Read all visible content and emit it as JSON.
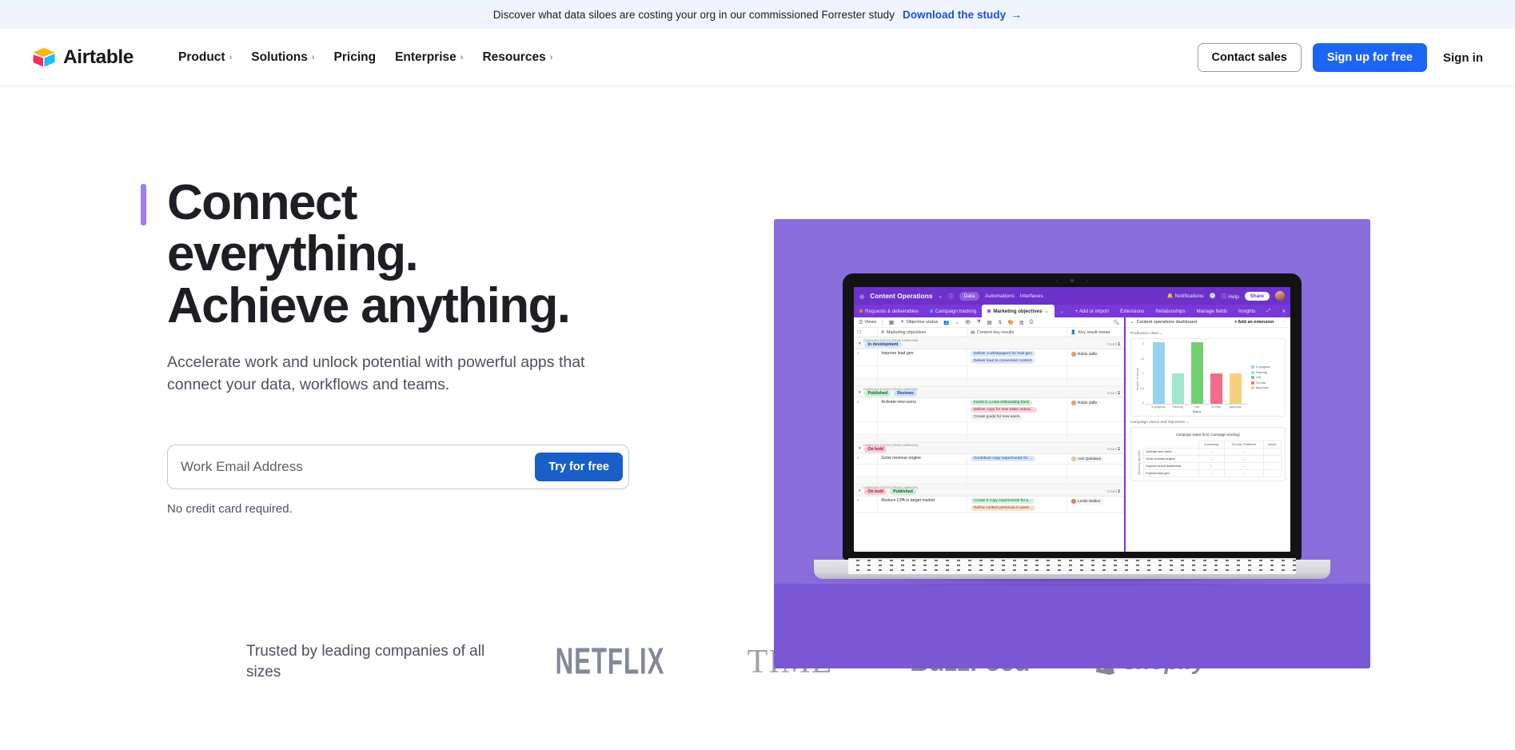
{
  "banner": {
    "text": "Discover what data siloes are costing your org in our commissioned Forrester study",
    "link_label": "Download the study",
    "arrow": "→"
  },
  "header": {
    "brand": "Airtable",
    "nav": [
      {
        "label": "Product",
        "has_chevron": true
      },
      {
        "label": "Solutions",
        "has_chevron": true
      },
      {
        "label": "Pricing",
        "has_chevron": false
      },
      {
        "label": "Enterprise",
        "has_chevron": true
      },
      {
        "label": "Resources",
        "has_chevron": true
      }
    ],
    "contact_sales": "Contact sales",
    "sign_up": "Sign up for free",
    "sign_in": "Sign in",
    "chevron_glyph": "›"
  },
  "hero": {
    "headline_line1": "Connect",
    "headline_line2": "everything.",
    "headline_line3": "Achieve anything.",
    "subhead": "Accelerate work and unlock potential with powerful apps that connect your data, workflows and teams.",
    "email_placeholder": "Work Email Address",
    "email_value": "",
    "cta": "Try for free",
    "disclaimer": "No credit card required.",
    "accent_color": "#9d7df0",
    "stage_color": "#8061d6"
  },
  "app": {
    "title": "Content Operations",
    "top_nav": [
      "Data",
      "Automations",
      "Interfaces"
    ],
    "notifications": "Notifications",
    "help": "Help",
    "share": "Share",
    "tabs": [
      {
        "label": "Requests & deliverables",
        "active": false,
        "dot": "#ff6f4f"
      },
      {
        "label": "Campaign tracking",
        "active": false,
        "dot": "#4ea1ff"
      },
      {
        "label": "Marketing objectives",
        "active": true,
        "dot": "#8b5cf6"
      }
    ],
    "add_or_import": "+ Add or import",
    "pane_tabs": [
      "Extensions",
      "Relationships",
      "Manage fields",
      "Insights"
    ],
    "toolbar": {
      "views": "Views",
      "objective_status": "Objective status",
      "search_icon": "search-icon"
    },
    "columns": [
      "",
      "Marketing objectives",
      "Content key results",
      "Key result owner"
    ],
    "group_label": "CAMPAIGN STATUS (FROM  CAMPAIGN)",
    "count_label": "Count",
    "groups": [
      {
        "chips": [
          {
            "text": "In development",
            "tone": "blue"
          }
        ],
        "count": "1",
        "rows": [
          {
            "num": "1",
            "objective": "Improve lead gen",
            "results": [
              {
                "text": "Deliver 3 whitepapers for lead gen",
                "tone": "b"
              },
              {
                "text": "Deliver lead to conversion content",
                "tone": "lb"
              }
            ],
            "owner": "Robin Jaffe",
            "owner_color": "#d8a27a"
          }
        ]
      },
      {
        "chips": [
          {
            "text": "Published",
            "tone": "green"
          },
          {
            "text": "Reviews",
            "tone": "lblue"
          }
        ],
        "count": "1",
        "rows": [
          {
            "num": "2",
            "objective": "Activate new users",
            "results": [
              {
                "text": "Invest in a new onboarding track",
                "tone": "g"
              },
              {
                "text": "Deliver copy for new sales onboa...",
                "tone": "p"
              },
              {
                "text": "Create guide for new users",
                "tone": "n"
              }
            ],
            "owner": "Robin Jaffe",
            "owner_color": "#d8a27a"
          }
        ]
      },
      {
        "chips": [
          {
            "text": "On hold",
            "tone": "pink"
          }
        ],
        "count": "1",
        "rows": [
          {
            "num": "3",
            "objective": "Grow revenue engine",
            "results": [
              {
                "text": "Contribute copy experiments for ...",
                "tone": "lb"
              }
            ],
            "owner": "Ash Quintana",
            "owner_color": "#e0c8a8"
          }
        ]
      },
      {
        "chips": [
          {
            "text": "On hold",
            "tone": "pink"
          },
          {
            "text": "Published",
            "tone": "green"
          }
        ],
        "count": "1",
        "rows": [
          {
            "num": "4",
            "objective": "Reduce CPA in target market",
            "results": [
              {
                "text": "Create 5 copy experiments for p...",
                "tone": "mg"
              },
              {
                "text": "Refine content personas in partn...",
                "tone": "or"
              }
            ],
            "owner": "Leslie Walker",
            "owner_color": "#c98b5e"
          }
        ]
      }
    ],
    "dashboard": {
      "title": "Content operations dashboard",
      "add_extension": "+ Add an extension",
      "chart_widget_label": "Production chart",
      "table_widget_label": "Campaign status and objectives",
      "table_title": "Campaign status (from  Campaign tracking)",
      "table_row_axis": "Marketing objectives",
      "table_headers": [
        "In planning",
        "On hold, Published",
        "develo"
      ],
      "table_rows": [
        {
          "name": "Activate new users",
          "cells": [
            "—",
            "—",
            ""
          ]
        },
        {
          "name": "Grow revenue engine",
          "cells": [
            "—",
            "—",
            ""
          ]
        },
        {
          "name": "Improve brand awareness",
          "cells": [
            "1",
            "—",
            ""
          ]
        },
        {
          "name": "Improve lead gen",
          "cells": [
            "—",
            "—",
            ""
          ]
        }
      ]
    }
  },
  "chart_data": {
    "type": "bar",
    "title": "Production chart",
    "categories": [
      "In progress",
      "Planning",
      "Live",
      "On hold",
      "Approvals"
    ],
    "values": [
      2,
      1,
      2,
      1,
      1
    ],
    "colors": [
      "#96d3ee",
      "#9fe6cd",
      "#72cf72",
      "#ef6d8a",
      "#f6d07d"
    ],
    "xlabel": "Status",
    "ylabel": "Number of records",
    "ylim": [
      0,
      2
    ],
    "yticks": [
      "2",
      "1.5",
      "1",
      "0.5",
      "0"
    ],
    "legend": [
      {
        "label": "In progress",
        "color": "#96d3ee"
      },
      {
        "label": "Planning",
        "color": "#9fe6cd"
      },
      {
        "label": "Live",
        "color": "#72cf72"
      },
      {
        "label": "On hold",
        "color": "#ef6d8a"
      },
      {
        "label": "Approvals",
        "color": "#f6d07d"
      }
    ],
    "legend_position": "right",
    "grid": false
  },
  "trusted": {
    "text": "Trusted by leading companies of all sizes",
    "logos": [
      "NETFLIX",
      "TIME",
      "BuzzFeed",
      "shopify"
    ]
  }
}
